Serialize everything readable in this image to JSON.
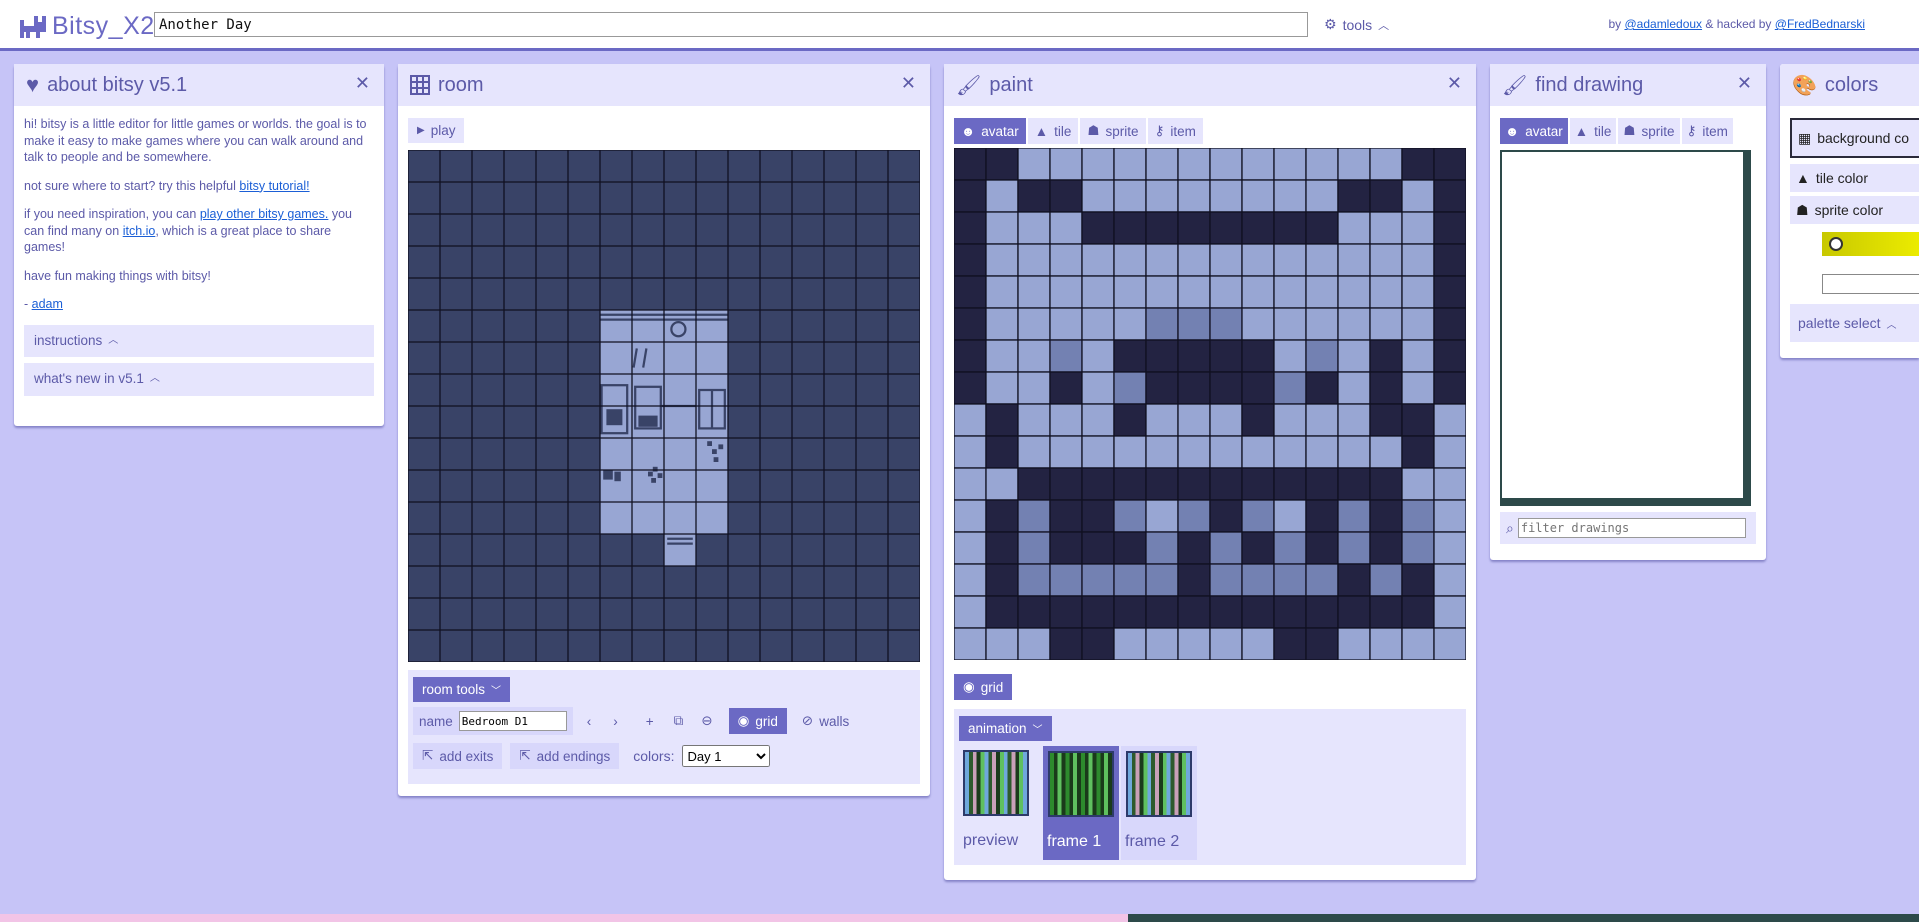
{
  "app": {
    "name": "Bitsy_X2",
    "game_title": "Another Day"
  },
  "topbar": {
    "tools_label": "tools",
    "credits_by": "by",
    "credits_author": "@adamledoux",
    "credits_hacked": "& hacked by",
    "credits_hacker": "@FredBednarski"
  },
  "about": {
    "title": "about bitsy v5.1",
    "p1": "hi! bitsy is a little editor for little games or worlds. the goal is to make it easy to make games where you can walk around and talk to people and be somewhere.",
    "p2_text": "not sure where to start? try this helpful",
    "p2_link": "bitsy tutorial!",
    "p3_a": "if you need inspiration, you can",
    "p3_link1": "play other bitsy games.",
    "p3_b": "you can find many on",
    "p3_link2": "itch.io",
    "p3_c": ", which is a great place to share games!",
    "p4": "have fun making things with bitsy!",
    "p5_dash": "-",
    "p5_link": "adam",
    "fold1": "instructions",
    "fold2": "what's new in v5.1"
  },
  "room": {
    "title": "room",
    "play_label": "play",
    "room_tools_label": "room tools",
    "name_label": "name",
    "name_value": "Bedroom D1",
    "grid_label": "grid",
    "walls_label": "walls",
    "add_exits_label": "add exits",
    "add_endings_label": "add endings",
    "colors_label": "colors:",
    "palette_value": "Day 1"
  },
  "paint": {
    "title": "paint",
    "tabs": [
      "avatar",
      "tile",
      "sprite",
      "item"
    ],
    "selected_tab": "avatar",
    "grid_label": "grid",
    "animation_label": "animation",
    "frames": [
      "preview",
      "frame 1",
      "frame 2"
    ],
    "selected_frame": "frame 1",
    "pixels": [
      "1100000000000011",
      "1011000000001101",
      "1000111111110001",
      "1000000000000001",
      "1000000000000001",
      "1000002220000001",
      "1002011111020101",
      "1001021111210101",
      "0100010001000110",
      "0100000000000010",
      "0011111111111100",
      "0121120212012120",
      "0121112121212120",
      "0122222122221210",
      "0111111111111110",
      "0001100000110000"
    ],
    "colors": {
      "dark": "#232342",
      "light": "#98a6d3",
      "mid": "#7381b2"
    }
  },
  "find": {
    "title": "find drawing",
    "tabs": [
      "avatar",
      "tile",
      "sprite",
      "item"
    ],
    "selected_tab": "avatar",
    "filter_placeholder": "filter drawings"
  },
  "colors": {
    "title": "colors",
    "background_label": "background co",
    "tile_label": "tile color",
    "sprite_label": "sprite color",
    "palette_select_label": "palette select",
    "swatches": {
      "page_bg": "#c6c4f7",
      "panel_head": "#e6e5fd",
      "accent": "#6b69c4",
      "room_bg": "#394367",
      "room_tile": "#98a6d3"
    }
  }
}
